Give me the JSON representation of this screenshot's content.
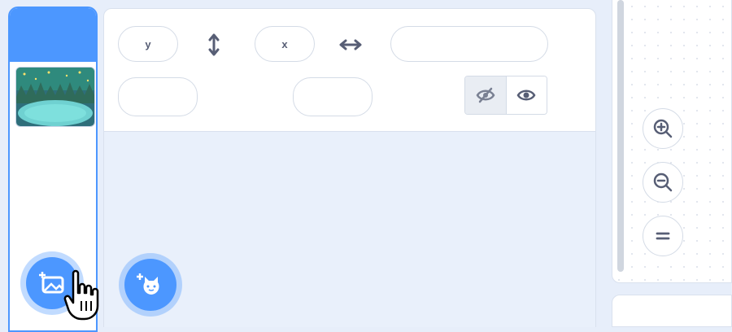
{
  "sprite_info": {
    "y_label": "y",
    "x_label": "x",
    "sprite_name_value": "",
    "size_value": "",
    "direction_value": "",
    "show_hidden_icon": "eye-slash-icon",
    "show_visible_icon": "eye-icon",
    "vertical_arrow_icon": "vertical-arrows-icon",
    "horizontal_arrow_icon": "horizontal-arrows-icon"
  },
  "stage_panel": {
    "backdrop_thumbnail_icon": "backdrop-thumbnail",
    "choose_backdrop_icon": "add-backdrop-icon",
    "choose_sprite_icon": "add-sprite-cat-icon"
  },
  "zoom": {
    "zoom_in_icon": "zoom-in-icon",
    "zoom_out_icon": "zoom-out-icon",
    "reset_icon": "zoom-reset-icon"
  },
  "colors": {
    "accent": "#4c97ff",
    "background": "#e7eefa",
    "text": "#575e75"
  }
}
